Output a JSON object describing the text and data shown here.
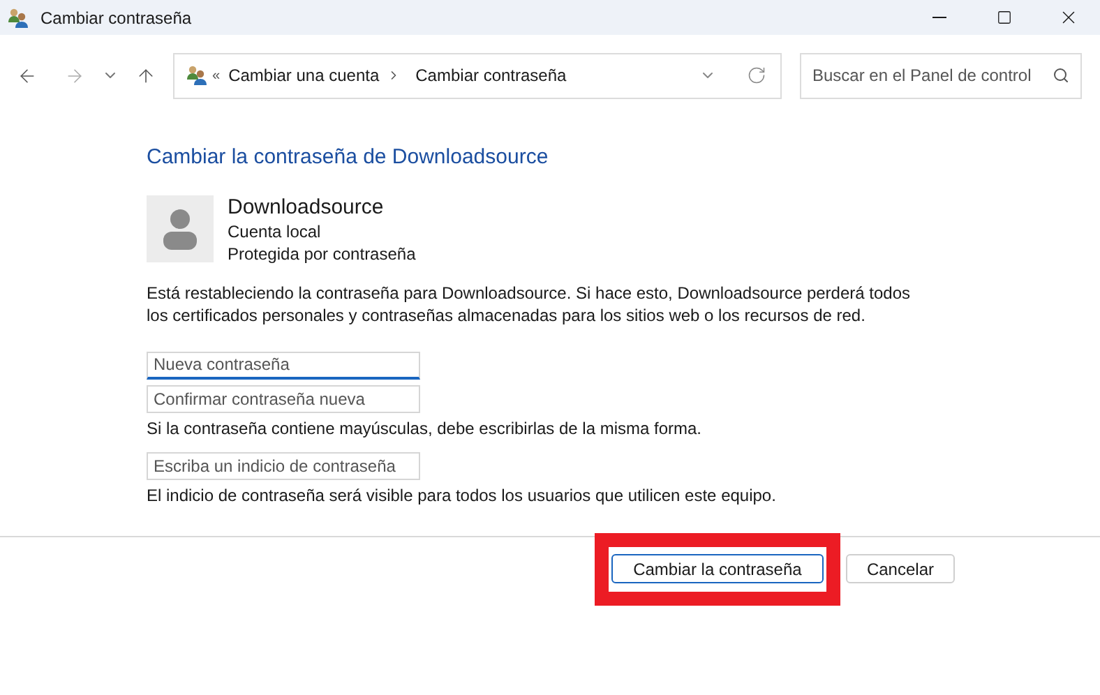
{
  "window": {
    "title": "Cambiar contraseña"
  },
  "address_bar": {
    "separator": "«",
    "crumbs": [
      "Cambiar una cuenta",
      "Cambiar contraseña"
    ]
  },
  "search": {
    "placeholder": "Buscar en el Panel de control"
  },
  "heading": "Cambiar la contraseña de Downloadsource",
  "account": {
    "name": "Downloadsource",
    "type": "Cuenta local",
    "status": "Protegida por contraseña"
  },
  "description": "Está restableciendo la contraseña para Downloadsource. Si hace esto, Downloadsource perderá todos los certificados personales y contraseñas almacenadas para los sitios web o los recursos de red.",
  "form": [
    {
      "kind": "field",
      "placeholder": "Nueva contraseña",
      "focused": true
    },
    {
      "kind": "field",
      "placeholder": "Confirmar contraseña nueva",
      "focused": false
    },
    {
      "kind": "note",
      "text": "Si la contraseña contiene mayúsculas, debe escribirlas de la misma forma."
    },
    {
      "kind": "field",
      "placeholder": "Escriba un indicio de contraseña",
      "focused": false
    },
    {
      "kind": "note",
      "text": "El indicio de contraseña será visible para todos los usuarios que utilicen este equipo."
    }
  ],
  "buttons": [
    {
      "label": "Cambiar la contraseña",
      "default": true,
      "highlighted": true
    },
    {
      "label": "Cancelar",
      "default": false,
      "highlighted": false
    }
  ]
}
